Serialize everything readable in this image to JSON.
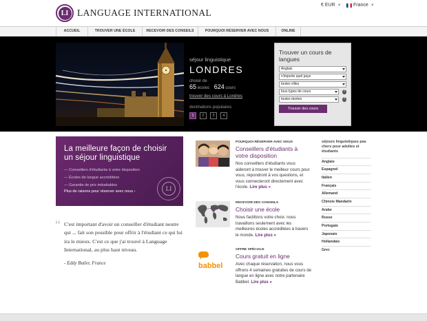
{
  "header": {
    "logo_mark": "LI",
    "site_name": "LANGUAGE INTERNATIONAL",
    "currency": "€ EUR",
    "country": "France"
  },
  "nav": {
    "items": [
      {
        "label": "ACCUEIL"
      },
      {
        "label": "TROUVER UNE ÉCOLE"
      },
      {
        "label": "RECEVOIR DES CONSEILS"
      },
      {
        "label": "POURQUOI RÉSERVER AVEC NOUS"
      },
      {
        "label": "ONLINE"
      }
    ]
  },
  "hero": {
    "kicker": "séjour linguistique",
    "city": "LONDRES",
    "choose_label": "choisir de",
    "schools_count": "65",
    "schools_label": "écoles",
    "courses_count": "624",
    "courses_label": "cours",
    "link": "trouver des cours à Londres",
    "popular_label": "destinations populaires",
    "pages": [
      "1",
      "2",
      "3",
      "4"
    ]
  },
  "finder": {
    "title": "Trouver un cours de langues",
    "selects": [
      {
        "value": "Anglais"
      },
      {
        "value": "n'importe quel pays"
      },
      {
        "value": "toutes villes"
      },
      {
        "value": "tous types de cours"
      },
      {
        "value": "toutes durées"
      }
    ],
    "help_glyph": "?",
    "button": "Trouver des cours"
  },
  "promo": {
    "title": "La meilleure façon de choisir un séjour linguistique",
    "bullets": [
      "— Conseillers d'étudiants à votre disposition",
      "— Écoles de langue accréditées",
      "— Garantie de prix imbattables"
    ],
    "more": "Plus de raisons pour réserver avec nous ›",
    "seal_mark": "LI"
  },
  "quote": {
    "mark": "“",
    "text": "C'est important d'avoir un conseiller d'étudiant neutre qui ... fait son possible pour offrir à l'étudiant ce qui lui ira le mieux. C'est ce que j'ai trouvé à Language International, au plus haut niveau.",
    "author": "- Eddy Butler, France"
  },
  "features": [
    {
      "kicker": "POURQUOI RÉSERVER AVEC NOUS",
      "title": "Conseillers d'étudiants à votre disposition",
      "body": "Nos conseillers d'étudiants vous aideront à trouver le meilleur cours pour vous, répondront à vos questions, et vous connecteront directement avec l'école.",
      "more": "Lire plus »",
      "icon": "students-photo"
    },
    {
      "kicker": "RECEVOIR DES CONSEILS",
      "title": "Choisir une école",
      "body": "Nous facilitons votre choix: nous travaillons seulement avec les meilleures écoles accréditées à travers le monde.",
      "more": "Lire plus »",
      "icon": "world-map"
    },
    {
      "kicker": "OFFRE SPÉCIALE",
      "title": "Cours gratuit en ligne",
      "body": "Avec chaque réservation, nous vous offrons 4 semaines gratuites de cours de langue en ligne avec notre partenaire Babbel.",
      "more": "Lire plus »",
      "icon": "babbel-logo",
      "logo_text": "babbel"
    }
  ],
  "sidebar": {
    "heading": "séjours linguistiques pas chers pour adultes et étudiants",
    "items": [
      {
        "label": "Anglais"
      },
      {
        "label": "Espagnol"
      },
      {
        "label": "Italien"
      },
      {
        "label": "Français"
      },
      {
        "label": "Allemand"
      },
      {
        "label": "Chinois Mandarin"
      },
      {
        "label": "Arabe"
      },
      {
        "label": "Russe"
      },
      {
        "label": "Portugais"
      },
      {
        "label": "Japonais"
      },
      {
        "label": "Hollandais"
      },
      {
        "label": "Grec"
      }
    ]
  },
  "colors": {
    "brand": "#6b2c70",
    "hero_bg": "#000000",
    "promo_bg": "#5e2564"
  }
}
